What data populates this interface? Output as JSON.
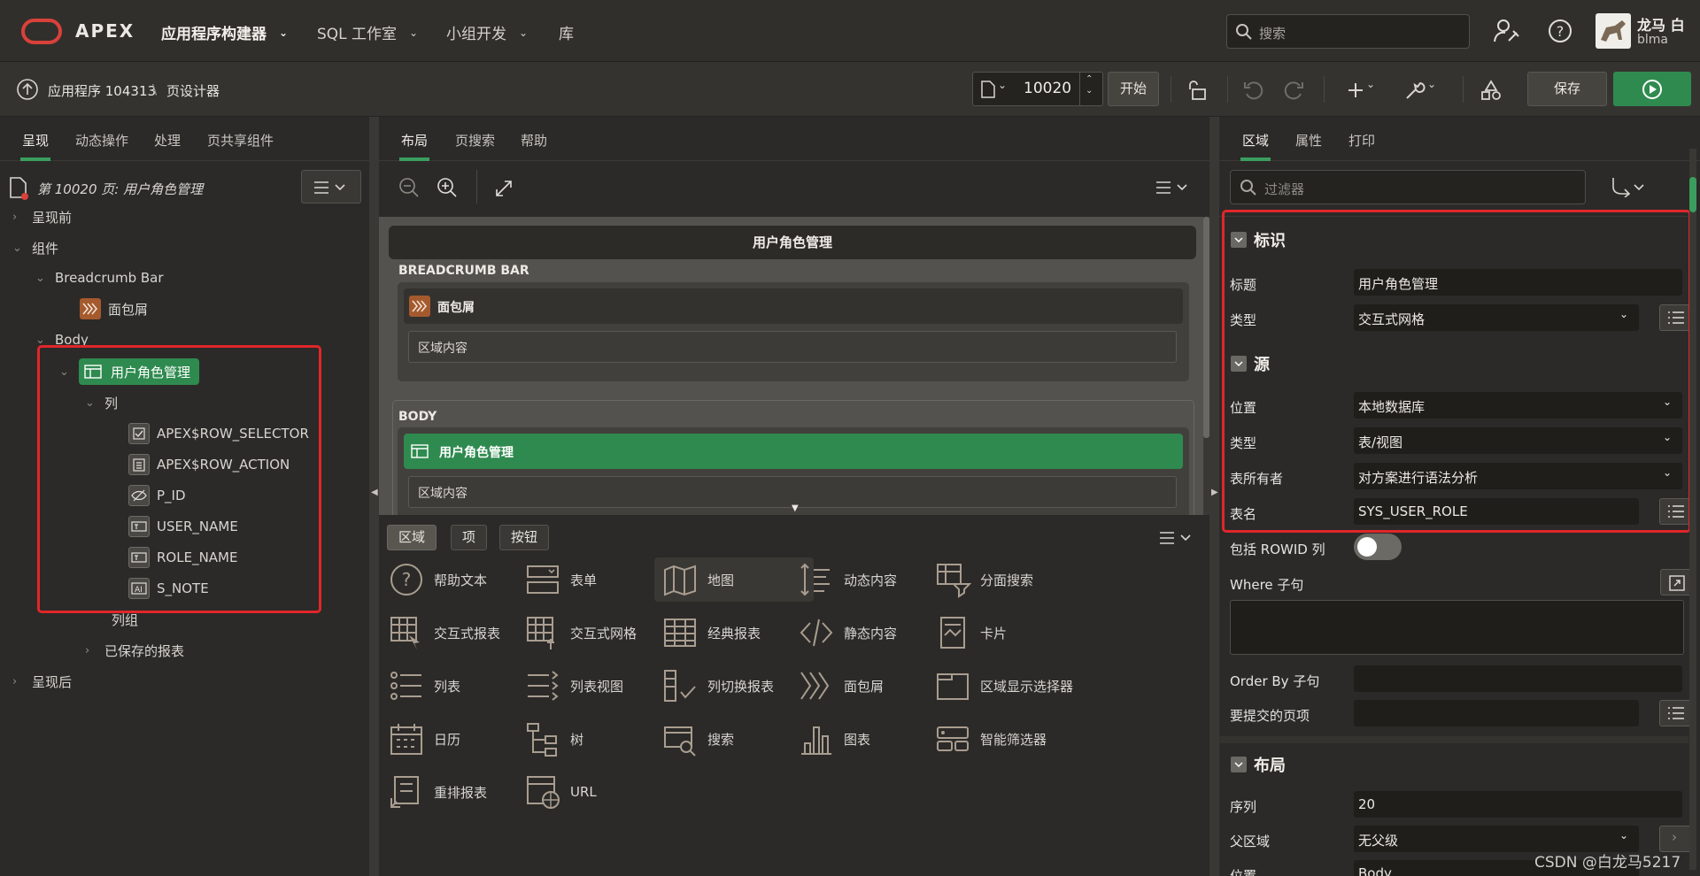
{
  "top_nav": {
    "brand": "APEX",
    "items": [
      {
        "label": "应用程序构建器"
      },
      {
        "label": "SQL 工作室"
      },
      {
        "label": "小组开发"
      },
      {
        "label": "库"
      }
    ],
    "search_placeholder": "搜索",
    "user_name": "龙马 白",
    "user_id": "blma"
  },
  "toolbar": {
    "app_crumb": "应用程序 104313",
    "page_crumb": "页设计器",
    "page_number": "10020",
    "go_label": "开始",
    "save_label": "保存"
  },
  "left_panel": {
    "tabs": [
      "呈现",
      "动态操作",
      "处理",
      "页共享组件"
    ],
    "page_title": "第 10020 页: 用户角色管理",
    "tree": {
      "before": "呈现前",
      "components": "组件",
      "breadcrumb_bar": "Breadcrumb Bar",
      "breadcrumb": "面包屑",
      "body": "Body",
      "region": "用户角色管理",
      "columns": "列",
      "col_items": [
        "APEX$ROW_SELECTOR",
        "APEX$ROW_ACTION",
        "P_ID",
        "USER_NAME",
        "ROLE_NAME",
        "S_NOTE"
      ],
      "column_groups": "列组",
      "saved_reports": "已保存的报表",
      "after": "呈现后"
    }
  },
  "mid_panel": {
    "tabs": [
      "布局",
      "页搜索",
      "帮助"
    ],
    "canvas": {
      "page_title": "用户角色管理",
      "breadcrumb_bar": "BREADCRUMB BAR",
      "breadcrumb_region": "面包屑",
      "region_content": "区域内容",
      "body": "BODY",
      "body_region": "用户角色管理",
      "body_region_content": "区域内容"
    },
    "gallery_tabs": [
      "区域",
      "项",
      "按钮"
    ],
    "gallery_items": [
      {
        "label": "帮助文本",
        "icon": "help-text-icon"
      },
      {
        "label": "表单",
        "icon": "form-icon"
      },
      {
        "label": "地图",
        "icon": "map-icon"
      },
      {
        "label": "动态内容",
        "icon": "dynamic-content-icon"
      },
      {
        "label": "分面搜索",
        "icon": "faceted-search-icon"
      },
      {
        "label": "交互式报表",
        "icon": "interactive-report-icon"
      },
      {
        "label": "交互式网格",
        "icon": "interactive-grid-icon"
      },
      {
        "label": "经典报表",
        "icon": "classic-report-icon"
      },
      {
        "label": "静态内容",
        "icon": "static-content-icon"
      },
      {
        "label": "卡片",
        "icon": "cards-icon"
      },
      {
        "label": "列表",
        "icon": "list-icon"
      },
      {
        "label": "列表视图",
        "icon": "list-view-icon"
      },
      {
        "label": "列切换报表",
        "icon": "column-toggle-report-icon"
      },
      {
        "label": "面包屑",
        "icon": "breadcrumb-icon"
      },
      {
        "label": "区域显示选择器",
        "icon": "region-display-selector-icon"
      },
      {
        "label": "日历",
        "icon": "calendar-icon"
      },
      {
        "label": "树",
        "icon": "tree-icon"
      },
      {
        "label": "搜索",
        "icon": "search-region-icon"
      },
      {
        "label": "图表",
        "icon": "chart-icon"
      },
      {
        "label": "智能筛选器",
        "icon": "smart-filter-icon"
      },
      {
        "label": "重排报表",
        "icon": "reflow-report-icon"
      },
      {
        "label": "URL",
        "icon": "url-icon"
      }
    ]
  },
  "right_panel": {
    "tabs": [
      "区域",
      "属性",
      "打印"
    ],
    "filter_placeholder": "过滤器",
    "sections": {
      "identification": "标识",
      "source": "源",
      "layout": "布局"
    },
    "props": {
      "title_label": "标题",
      "title_value": "用户角色管理",
      "type_label": "类型",
      "type_value": "交互式网格",
      "location_label": "位置",
      "location_value": "本地数据库",
      "source_type_label": "类型",
      "source_type_value": "表/视图",
      "owner_label": "表所有者",
      "owner_value": "对方案进行语法分析",
      "table_label": "表名",
      "table_value": "SYS_USER_ROLE",
      "rowid_label": "包括 ROWID 列",
      "where_label": "Where 子句",
      "orderby_label": "Order By 子句",
      "submit_label": "要提交的页项",
      "seq_label": "序列",
      "seq_value": "20",
      "parent_label": "父区域",
      "parent_value": "无父级",
      "position_label": "位置",
      "position_value": "Body"
    }
  },
  "watermark": "CSDN @白龙马5217",
  "colors": {
    "accent_green": "#2f8a4f",
    "highlight_red": "#e0262a",
    "oracle_red": "#d9413a",
    "breadcrumb_orange": "#a55a2e"
  }
}
